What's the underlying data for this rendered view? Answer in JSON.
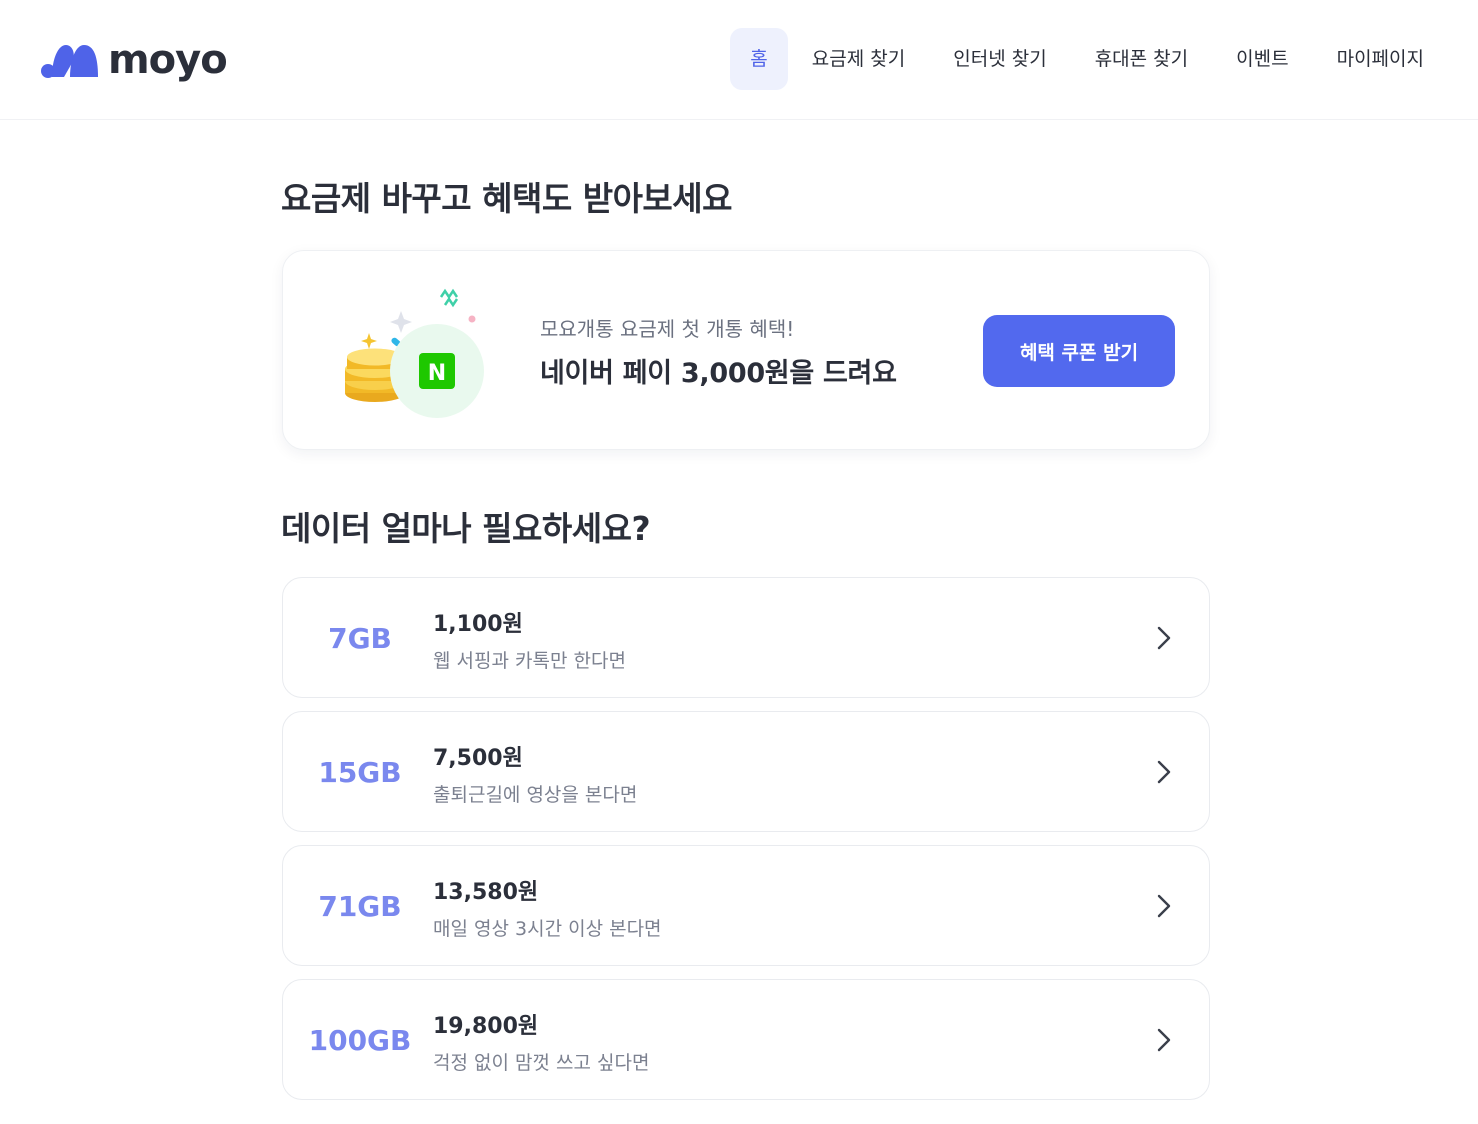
{
  "header": {
    "logo_text": "moyo",
    "nav": [
      {
        "label": "홈",
        "active": true
      },
      {
        "label": "요금제 찾기",
        "active": false
      },
      {
        "label": "인터넷 찾기",
        "active": false
      },
      {
        "label": "휴대폰 찾기",
        "active": false
      },
      {
        "label": "이벤트",
        "active": false
      },
      {
        "label": "마이페이지",
        "active": false
      }
    ]
  },
  "promo_section": {
    "title": "요금제 바꾸고 혜택도 받아보세요",
    "banner": {
      "subtitle": "모요개통 요금제 첫 개통 혜택!",
      "headline": "네이버 페이 3,000원을 드려요",
      "badge_letter": "N",
      "button_label": "혜택 쿠폰 받기"
    }
  },
  "data_section": {
    "title": "데이터 얼마나 필요하세요?",
    "plans": [
      {
        "data": "7GB",
        "price": "1,100원",
        "desc": "웹 서핑과 카톡만 한다면"
      },
      {
        "data": "15GB",
        "price": "7,500원",
        "desc": "출퇴근길에 영상을 본다면"
      },
      {
        "data": "71GB",
        "price": "13,580원",
        "desc": "매일 영상 3시간 이상 본다면"
      },
      {
        "data": "100GB",
        "price": "19,800원",
        "desc": "걱정 없이 맘껏 쓰고 싶다면"
      }
    ]
  },
  "colors": {
    "brand": "#5269ee",
    "data_label": "#7a88ee",
    "active_nav_bg": "#eef1fd",
    "naver_green": "#1ec800"
  },
  "icons": {
    "logo": "moyo-logo-icon",
    "chevron": "chevron-right-icon"
  }
}
